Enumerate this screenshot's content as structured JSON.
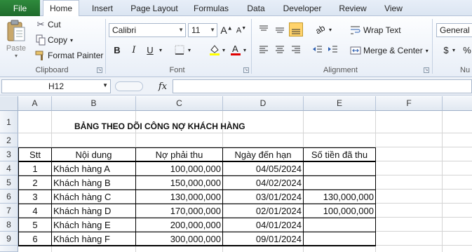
{
  "tabs": {
    "file": "File",
    "items": [
      "Home",
      "Insert",
      "Page Layout",
      "Formulas",
      "Data",
      "Developer",
      "Review",
      "View"
    ]
  },
  "ribbon": {
    "clipboard": {
      "paste": "Paste",
      "cut": "Cut",
      "copy": "Copy",
      "format_painter": "Format Painter",
      "label": "Clipboard"
    },
    "font": {
      "name": "Calibri",
      "size": "11",
      "bold": "B",
      "italic": "I",
      "underline": "U",
      "label": "Font"
    },
    "alignment": {
      "wrap_text": "Wrap Text",
      "merge_center": "Merge & Center",
      "label": "Alignment"
    },
    "number": {
      "format": "General",
      "currency": "$",
      "percent": "%",
      "label": "Nu"
    }
  },
  "formula_bar": {
    "name_box": "H12",
    "fx": "fx",
    "value": ""
  },
  "columns": [
    "A",
    "B",
    "C",
    "D",
    "E",
    "F"
  ],
  "rows": [
    "1",
    "2",
    "3",
    "4",
    "5",
    "6",
    "7",
    "8",
    "9"
  ],
  "sheet": {
    "title": "BẢNG THEO DÕI CÔNG NỢ KHÁCH HÀNG",
    "headers": [
      "Stt",
      "Nội dung",
      "Nợ phải thu",
      "Ngày đến hạn",
      "Số tiền đã thu"
    ],
    "data": [
      [
        "1",
        "Khách hàng A",
        "100,000,000",
        "04/05/2024",
        ""
      ],
      [
        "2",
        "Khách hàng B",
        "150,000,000",
        "04/02/2024",
        ""
      ],
      [
        "3",
        "Khách hàng C",
        "130,000,000",
        "03/01/2024",
        "130,000,000"
      ],
      [
        "4",
        "Khách hàng D",
        "170,000,000",
        "02/01/2024",
        "100,000,000"
      ],
      [
        "5",
        "Khách hàng E",
        "200,000,000",
        "04/01/2024",
        ""
      ],
      [
        "6",
        "Khách hàng F",
        "300,000,000",
        "09/01/2024",
        ""
      ]
    ]
  },
  "colors": {
    "file_tab": "#1f6b2c",
    "ribbon_bg": "#e8eef7",
    "font_color_bar": "#e00000",
    "fill_color_bar": "#ffff00",
    "active_align": "#ffd36b"
  }
}
